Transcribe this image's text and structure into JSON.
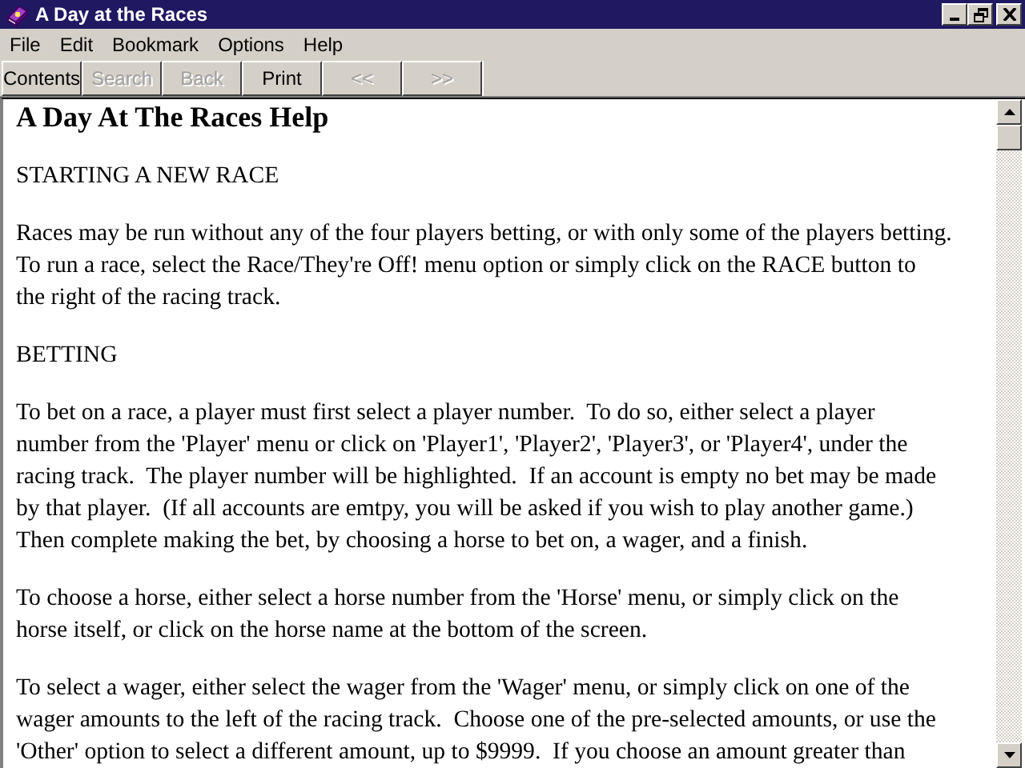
{
  "window": {
    "title": "A Day at the Races"
  },
  "menu": [
    {
      "label": "File"
    },
    {
      "label": "Edit"
    },
    {
      "label": "Bookmark"
    },
    {
      "label": "Options"
    },
    {
      "label": "Help"
    }
  ],
  "toolbar": [
    {
      "label": "Contents",
      "disabled": false
    },
    {
      "label": "Search",
      "disabled": true
    },
    {
      "label": "Back",
      "disabled": true
    },
    {
      "label": "Print",
      "disabled": false
    },
    {
      "label": "<<",
      "disabled": true
    },
    {
      "label": ">>",
      "disabled": true
    }
  ],
  "content": {
    "heading": "A Day At The Races Help",
    "blocks": [
      {
        "lines": [
          "STARTING A NEW RACE"
        ]
      },
      {
        "lines": [
          "Races may be run without any of the four players betting, or with only some of the players betting.",
          "To run a race, select the Race/They're Off! menu option or simply click on the RACE button to",
          "the right of the racing track."
        ]
      },
      {
        "lines": [
          "BETTING"
        ]
      },
      {
        "lines": [
          "To bet on a race, a player must first select a player number.  To do so, either select a player",
          "number from the 'Player' menu or click on 'Player1', 'Player2', 'Player3', or 'Player4', under the",
          "racing track.  The player number will be highlighted.  If an account is empty no bet may be made",
          "by that player.  (If all accounts are emtpy, you will be asked if you wish to play another game.)",
          "Then complete making the bet, by choosing a horse to bet on, a wager, and a finish."
        ]
      },
      {
        "lines": [
          "To choose a horse, either select a horse number from the 'Horse' menu, or simply click on the",
          "horse itself, or click on the horse name at the bottom of the screen."
        ]
      },
      {
        "lines": [
          "To select a wager, either select the wager from the 'Wager' menu, or simply click on one of the",
          "wager amounts to the left of the racing track.  Choose one of the pre-selected amounts, or use the",
          "'Other' option to select a different amount, up to $9999.  If you choose an amount greater than"
        ]
      }
    ]
  }
}
